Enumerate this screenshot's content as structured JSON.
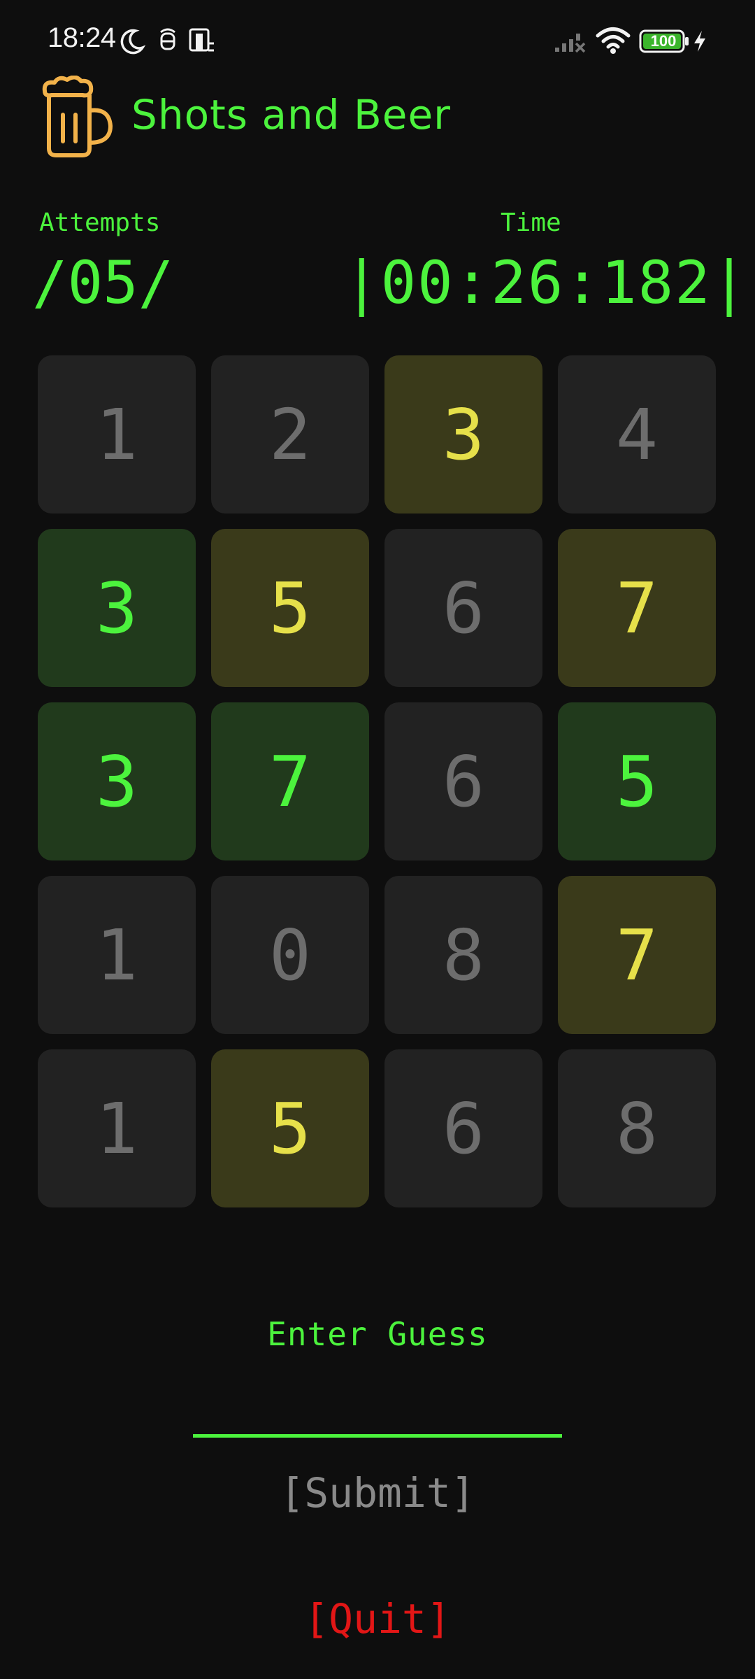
{
  "status_bar": {
    "time": "18:24",
    "battery": "100",
    "icons": [
      "moon-icon",
      "notification-icon",
      "phone-icon",
      "signal-icon",
      "wifi-icon",
      "battery-icon",
      "charging-icon"
    ]
  },
  "header": {
    "title": "Shots and Beer",
    "logo_icon": "beer-mug-icon",
    "logo_color": "#f2b24a"
  },
  "stats": {
    "attempts_label": "Attempts",
    "attempts_value": "/05/",
    "time_label": "Time",
    "time_value": "|00:26:182|"
  },
  "colors": {
    "accent": "#4cf33d",
    "cell_gray_bg": "#222222",
    "cell_gray_text": "#6d6d6d",
    "cell_yellow_bg": "#3a3a1a",
    "cell_yellow_text": "#e6e04a",
    "cell_green_bg": "#213a1c",
    "cell_green_text": "#4cf33d",
    "quit": "#e21616",
    "submit": "#8a8a8a"
  },
  "grid": {
    "rows": [
      [
        {
          "digit": "1",
          "state": "gray"
        },
        {
          "digit": "2",
          "state": "gray"
        },
        {
          "digit": "3",
          "state": "yellow"
        },
        {
          "digit": "4",
          "state": "gray"
        }
      ],
      [
        {
          "digit": "3",
          "state": "green"
        },
        {
          "digit": "5",
          "state": "yellow"
        },
        {
          "digit": "6",
          "state": "gray"
        },
        {
          "digit": "7",
          "state": "yellow"
        }
      ],
      [
        {
          "digit": "3",
          "state": "green"
        },
        {
          "digit": "7",
          "state": "green"
        },
        {
          "digit": "6",
          "state": "gray"
        },
        {
          "digit": "5",
          "state": "green"
        }
      ],
      [
        {
          "digit": "1",
          "state": "gray"
        },
        {
          "digit": "0",
          "state": "gray"
        },
        {
          "digit": "8",
          "state": "gray"
        },
        {
          "digit": "7",
          "state": "yellow"
        }
      ],
      [
        {
          "digit": "1",
          "state": "gray"
        },
        {
          "digit": "5",
          "state": "yellow"
        },
        {
          "digit": "6",
          "state": "gray"
        },
        {
          "digit": "8",
          "state": "gray"
        }
      ]
    ]
  },
  "guess": {
    "label": "Enter Guess",
    "value": "",
    "placeholder": ""
  },
  "buttons": {
    "submit": "[Submit]",
    "quit": "[Quit]"
  }
}
